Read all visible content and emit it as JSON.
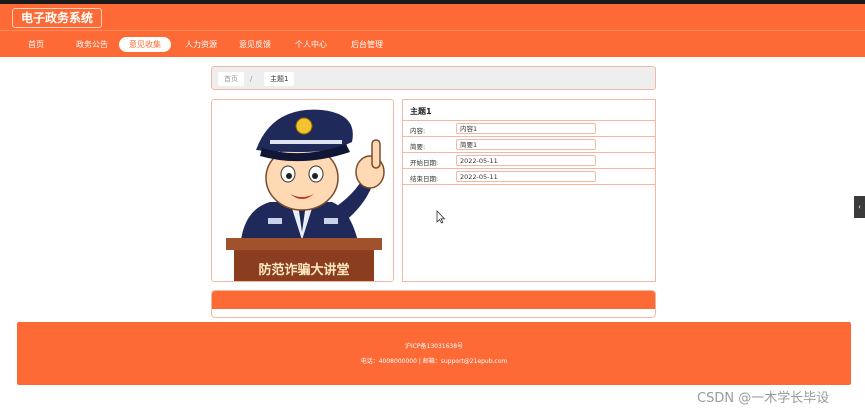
{
  "app": {
    "title": "电子政务系统"
  },
  "nav": {
    "items": [
      {
        "label": "首页"
      },
      {
        "label": "政务公告"
      },
      {
        "label": "意见收集"
      },
      {
        "label": "人力资源"
      },
      {
        "label": "意见反馈"
      },
      {
        "label": "个人中心"
      },
      {
        "label": "后台管理"
      }
    ],
    "active": "意见收集"
  },
  "breadcrumb": {
    "home": "首页",
    "separator": "/",
    "current": "主题1"
  },
  "image": {
    "banner_text": "防范诈骗大讲堂"
  },
  "detail": {
    "title": "主题1",
    "fields": [
      {
        "label": "内容:",
        "value": "内容1"
      },
      {
        "label": "简要:",
        "value": "简要1"
      },
      {
        "label": "开始日期:",
        "value": "2022-05-11"
      },
      {
        "label": "结束日期:",
        "value": "2022-05-11"
      }
    ]
  },
  "footer": {
    "icp": "沪ICP备13031638号",
    "contact": "电话：4008000000 | 邮箱：support@21epub.com"
  },
  "side_tab": {
    "icon": "chevron-left-icon",
    "glyph": "‹"
  },
  "watermark": "CSDN @一木学长毕设",
  "colors": {
    "accent": "#fe6a36",
    "border": "#f4b8a2"
  }
}
